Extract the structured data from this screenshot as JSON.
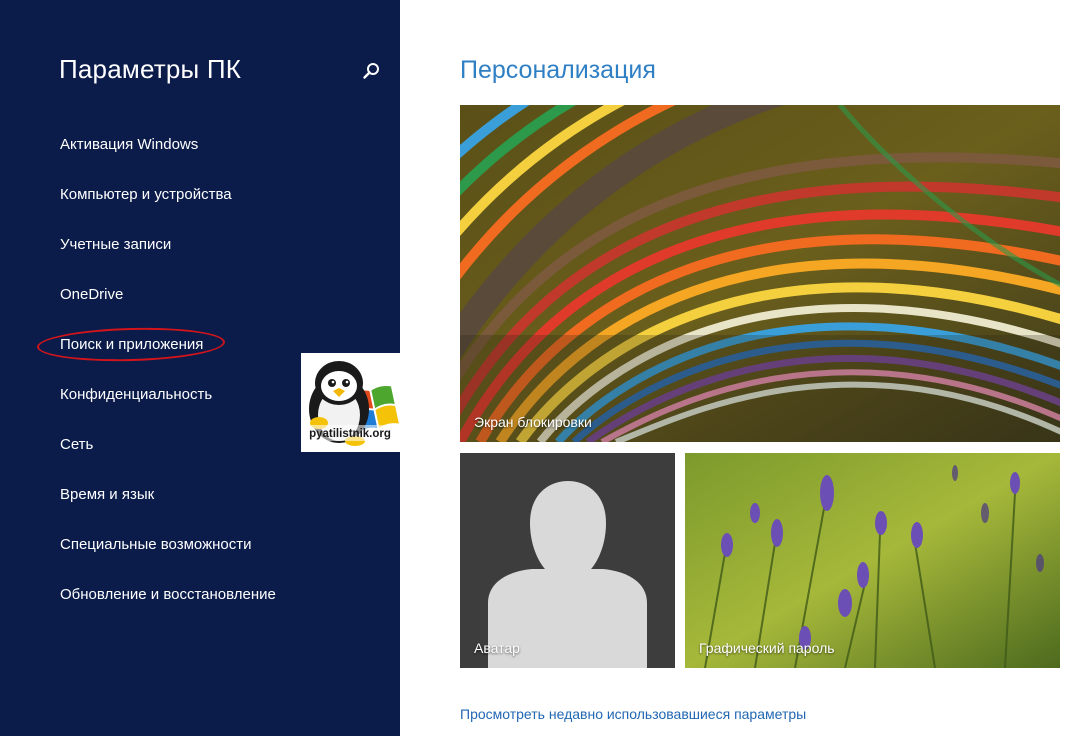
{
  "sidebar": {
    "title": "Параметры ПК",
    "search_icon": "search-icon",
    "items": [
      {
        "label": "Активация Windows"
      },
      {
        "label": "Компьютер и устройства"
      },
      {
        "label": "Учетные записи"
      },
      {
        "label": "OneDrive"
      },
      {
        "label": "Поиск и приложения",
        "highlighted": true
      },
      {
        "label": "Конфиденциальность"
      },
      {
        "label": "Сеть"
      },
      {
        "label": "Время и язык"
      },
      {
        "label": "Специальные возможности"
      },
      {
        "label": "Обновление и восстановление"
      }
    ]
  },
  "watermark": {
    "text": "pyatilistnik.org"
  },
  "main": {
    "title": "Персонализация",
    "tiles": {
      "lock_screen": {
        "label": "Экран блокировки"
      },
      "avatar": {
        "label": "Аватар"
      },
      "picture_password": {
        "label": "Графический пароль"
      }
    },
    "recent_link": "Просмотреть недавно использовавшиеся параметры"
  },
  "colors": {
    "sidebar_bg": "#0b1c4a",
    "accent": "#2e7fc4",
    "highlight_ring": "#d4141b"
  }
}
